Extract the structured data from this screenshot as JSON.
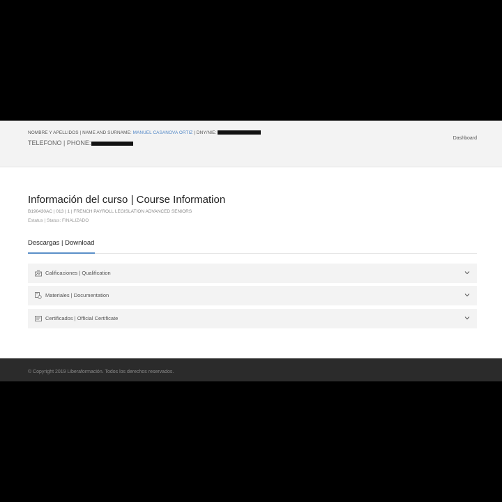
{
  "header": {
    "name_label": "NOMBRE Y APELLIDOS | NAME AND SURNAME:",
    "user_name": "MANUEL CASANOVA ORTIZ",
    "dni_label": "| DNY/NIE:",
    "phone_label": "TELEFONO | PHONE:",
    "dashboard_link": "Dashboard"
  },
  "course": {
    "title": "Información del curso | Course Information",
    "code_line": "B190430AC | 013 | 1 | FRENCH PAYROLL LEGISLATION ADVANCED SENIORS",
    "status_line": "Estatus | Status: FINALIZADO"
  },
  "tabs": [
    {
      "label": "Descargas | Download",
      "active": true
    }
  ],
  "downloads": [
    {
      "label": "Calificaciones | Qualification",
      "icon": "report-card-icon"
    },
    {
      "label": "Materiales | Documentation",
      "icon": "documents-icon"
    },
    {
      "label": "Certificados | Official Certificate",
      "icon": "certificate-icon"
    }
  ],
  "footer": {
    "copyright": "© Copyright 2019 Liberaformación. Todos los derechos reservados."
  },
  "colors": {
    "accent": "#5a8fc8",
    "link": "#4f86c6",
    "header_bg": "#f3f3f3",
    "footer_bg": "#2b2b2b"
  }
}
